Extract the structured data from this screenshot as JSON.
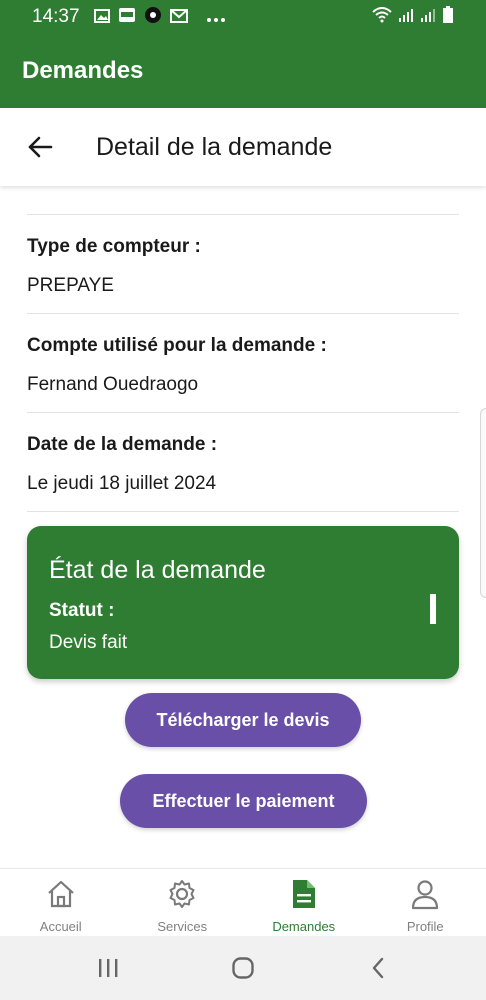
{
  "status_bar": {
    "time": "14:37",
    "icons": [
      "image-icon",
      "pdf-icon",
      "circle-app-icon",
      "mail-icon",
      "more-dots-icon"
    ],
    "right_icons": [
      "wifi-icon",
      "signal-icon",
      "signal-icon",
      "battery-icon"
    ]
  },
  "app_bar": {
    "title": "Demandes"
  },
  "header": {
    "title": "Detail de la demande",
    "back_icon": "arrow-left-icon"
  },
  "details": [
    {
      "label": "Type de compteur :",
      "value": "PREPAYE"
    },
    {
      "label": "Compte utilisé pour la demande :",
      "value": "Fernand Ouedraogo"
    },
    {
      "label": "Date de la demande :",
      "value": "Le jeudi 18 juillet 2024"
    }
  ],
  "state_card": {
    "title": "État de la demande",
    "status_label": "Statut :",
    "status_value": "Devis fait"
  },
  "buttons": {
    "download": "Télécharger le devis",
    "pay": "Effectuer le paiement"
  },
  "bottom_nav": {
    "items": [
      {
        "label": "Accueil",
        "icon": "home-icon",
        "active": false
      },
      {
        "label": "Services",
        "icon": "gear-icon",
        "active": false
      },
      {
        "label": "Demandes",
        "icon": "document-icon",
        "active": true
      },
      {
        "label": "Profile",
        "icon": "person-icon",
        "active": false
      }
    ]
  },
  "system_nav": {
    "icons": [
      "recent-apps-icon",
      "home-circle-icon",
      "back-chevron-icon"
    ]
  },
  "colors": {
    "primary": "#2e7d32",
    "accent_button": "#6a4fa8",
    "nav_inactive": "#808080"
  }
}
